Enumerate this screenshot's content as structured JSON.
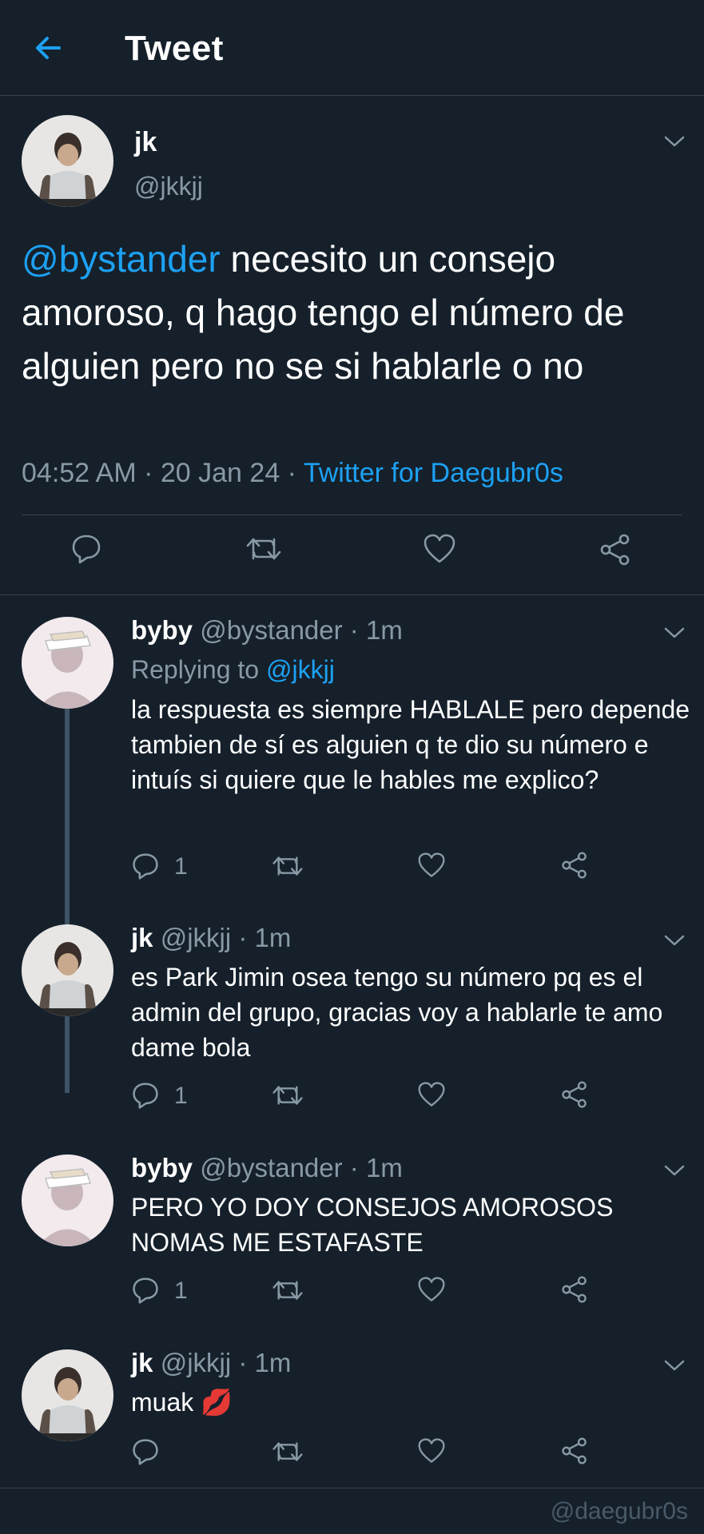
{
  "header": {
    "title": "Tweet",
    "back_icon": "arrow-left-icon",
    "accent": "#1da1f2"
  },
  "main_tweet": {
    "name": "jk",
    "handle": "@jkkjj",
    "mention": "@bystander",
    "text": " necesito un consejo amoroso, q hago tengo el número de alguien pero no se si hablarle o no",
    "time": "04:52 AM",
    "sep1": " · ",
    "date": "20 Jan 24",
    "sep2": " · ",
    "client": "Twitter for Daegubr0s"
  },
  "replies": [
    {
      "name": "byby",
      "handle": "@bystander",
      "time": "1m",
      "replying_label": "Replying to ",
      "replying_to": "@jkkjj",
      "text": "la respuesta es siempre HABLALE pero depende tambien de sí es alguien q te dio su número e intuís si quiere que le hables me explico?",
      "reply_count": "1"
    },
    {
      "name": "jk",
      "handle": "@jkkjj",
      "time": "1m",
      "text": "es Park Jimin osea tengo su número pq es el admin del grupo, gracias voy a hablarle te amo dame bola",
      "reply_count": "1"
    },
    {
      "name": "byby",
      "handle": "@bystander",
      "time": "1m",
      "text": "PERO YO DOY CONSEJOS AMOROSOS NOMAS ME ESTAFASTE",
      "reply_count": "1"
    },
    {
      "name": "jk",
      "handle": "@jkkjj",
      "time": "1m",
      "text": "muak 💋",
      "reply_count": ""
    }
  ],
  "watermark": "@daegubr0s"
}
